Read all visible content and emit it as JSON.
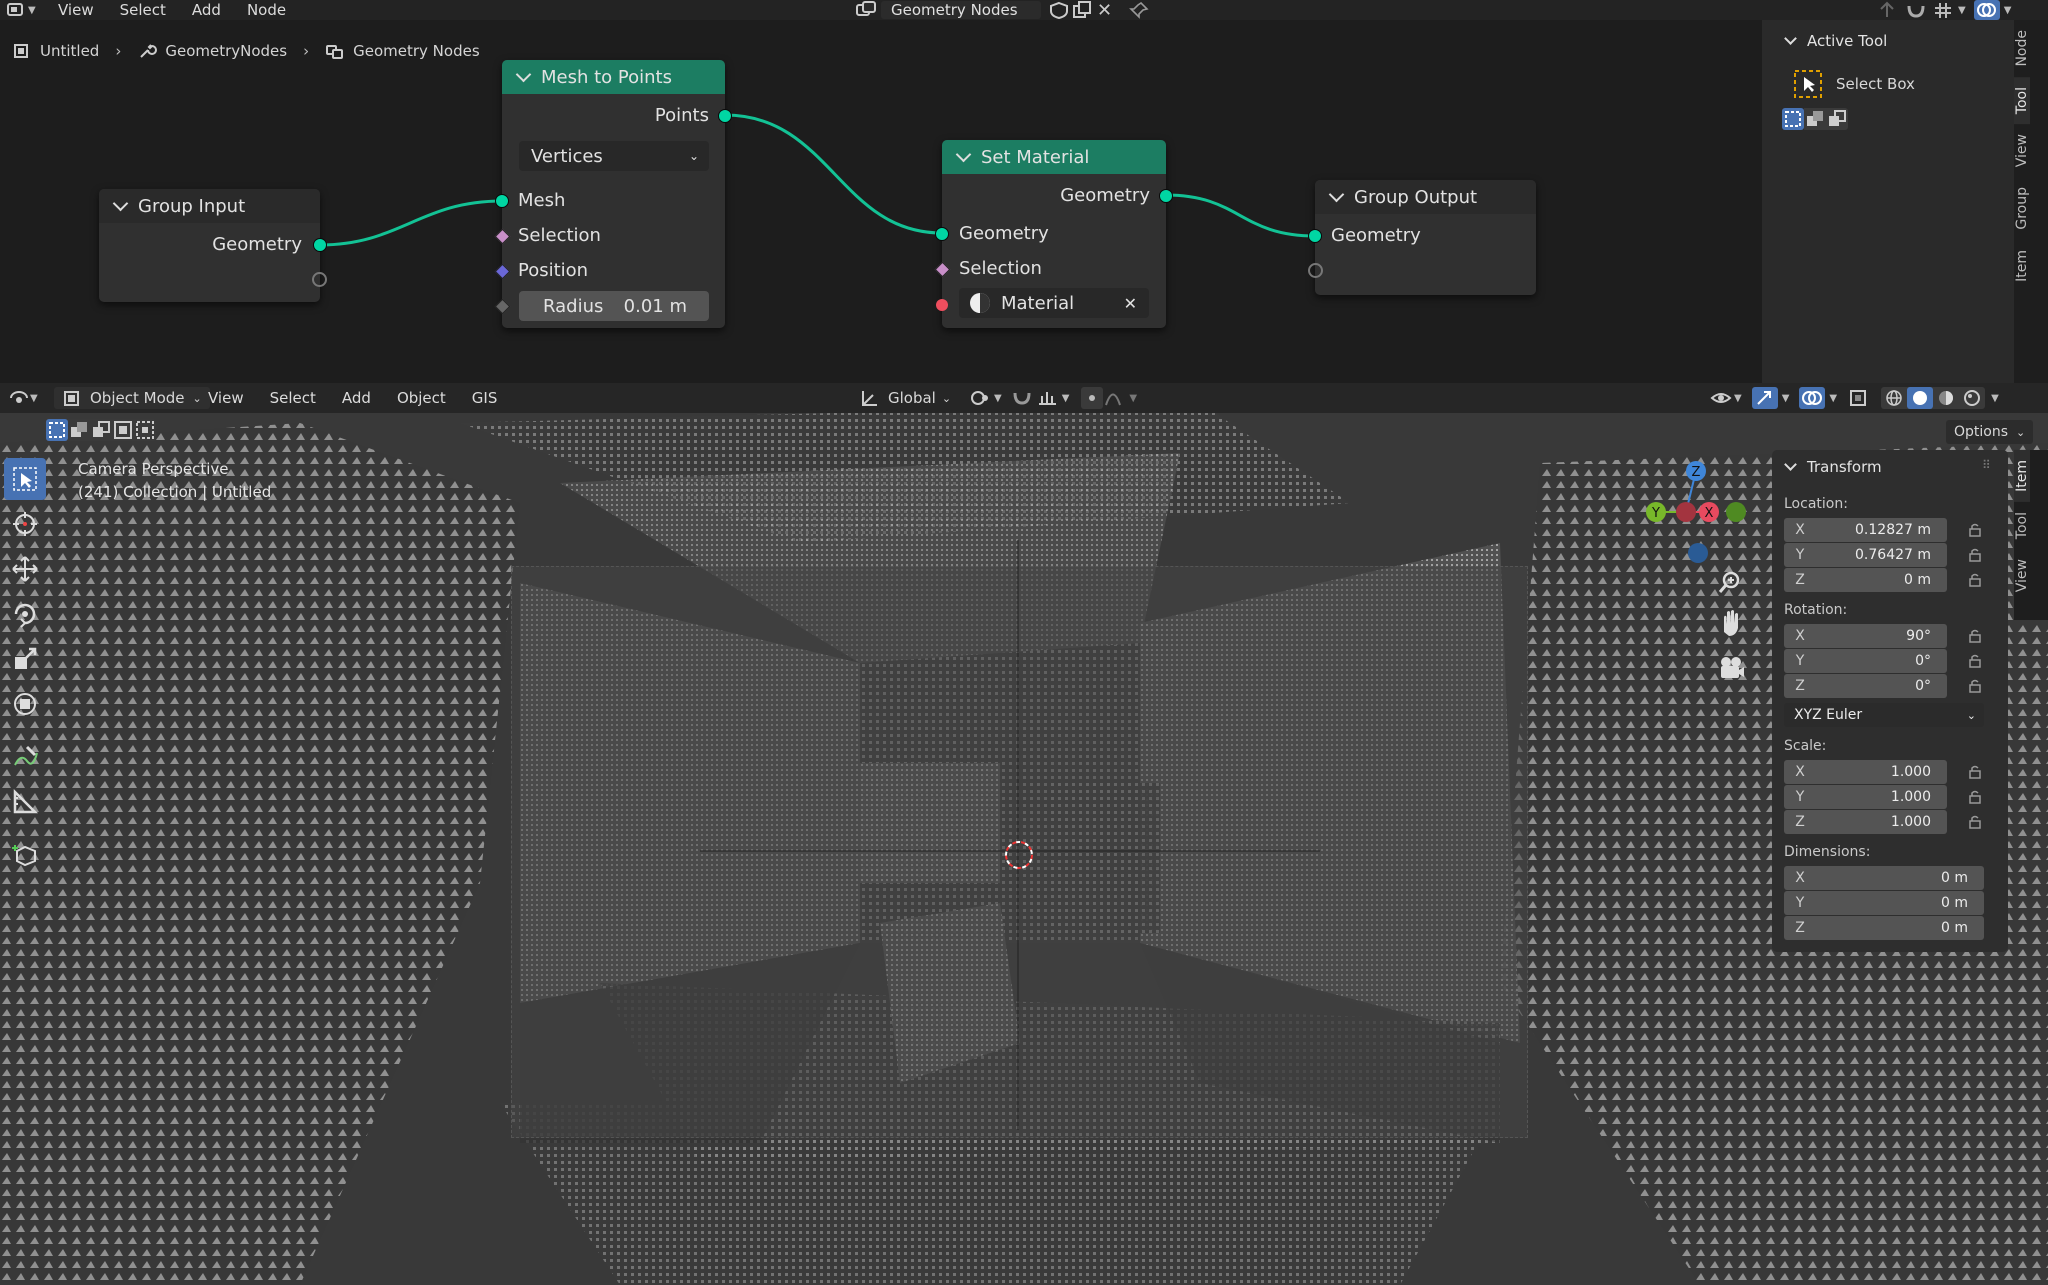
{
  "top_menu": {
    "items": [
      "View",
      "Select",
      "Add",
      "Node"
    ]
  },
  "node_tree_name": "Geometry Nodes",
  "breadcrumb": {
    "items": [
      "Untitled",
      "GeometryNodes",
      "Geometry Nodes"
    ]
  },
  "nodes": {
    "group_input": {
      "title": "Group Input",
      "outputs": [
        "Geometry"
      ]
    },
    "mesh_to_points": {
      "title": "Mesh to Points",
      "output": "Points",
      "mode": "Vertices",
      "inputs": [
        "Mesh",
        "Selection",
        "Position"
      ],
      "radius_label": "Radius",
      "radius_value": "0.01 m"
    },
    "set_material": {
      "title": "Set Material",
      "output": "Geometry",
      "inputs": [
        "Geometry",
        "Selection"
      ],
      "material_label": "Material"
    },
    "group_output": {
      "title": "Group Output",
      "inputs": [
        "Geometry"
      ]
    }
  },
  "node_sidebar": {
    "tabs": [
      "Node",
      "Tool",
      "View",
      "Group",
      "Item"
    ],
    "active_tool_title": "Active Tool",
    "tool_name": "Select Box"
  },
  "viewport_header": {
    "mode": "Object Mode",
    "menus": [
      "View",
      "Select",
      "Add",
      "Object",
      "GIS"
    ],
    "orientation": "Global",
    "options_label": "Options"
  },
  "viewport_info": {
    "line1": "Camera Perspective",
    "line2": "(241) Collection | Untitled"
  },
  "gizmo": {
    "axes": [
      "Z",
      "Y",
      "X"
    ]
  },
  "transform_panel": {
    "title": "Transform",
    "location_label": "Location:",
    "location": [
      {
        "axis": "X",
        "value": "0.12827 m"
      },
      {
        "axis": "Y",
        "value": "0.76427 m"
      },
      {
        "axis": "Z",
        "value": "0 m"
      }
    ],
    "rotation_label": "Rotation:",
    "rotation": [
      {
        "axis": "X",
        "value": "90°"
      },
      {
        "axis": "Y",
        "value": "0°"
      },
      {
        "axis": "Z",
        "value": "0°"
      }
    ],
    "rotation_mode": "XYZ Euler",
    "scale_label": "Scale:",
    "scale": [
      {
        "axis": "X",
        "value": "1.000"
      },
      {
        "axis": "Y",
        "value": "1.000"
      },
      {
        "axis": "Z",
        "value": "1.000"
      }
    ],
    "dimensions_label": "Dimensions:",
    "dimensions": [
      {
        "axis": "X",
        "value": "0 m"
      },
      {
        "axis": "Y",
        "value": "0 m"
      },
      {
        "axis": "Z",
        "value": "0 m"
      }
    ]
  },
  "viewport_sidebar_tabs": [
    "Item",
    "Tool",
    "View"
  ],
  "colors": {
    "node_header_green": "#1c7d62",
    "geometry_socket": "#00d6a3",
    "active_tool_blue": "#4772b3",
    "axis_x": "#e84a5f",
    "axis_y": "#78b82a",
    "axis_z": "#3f86d9"
  }
}
